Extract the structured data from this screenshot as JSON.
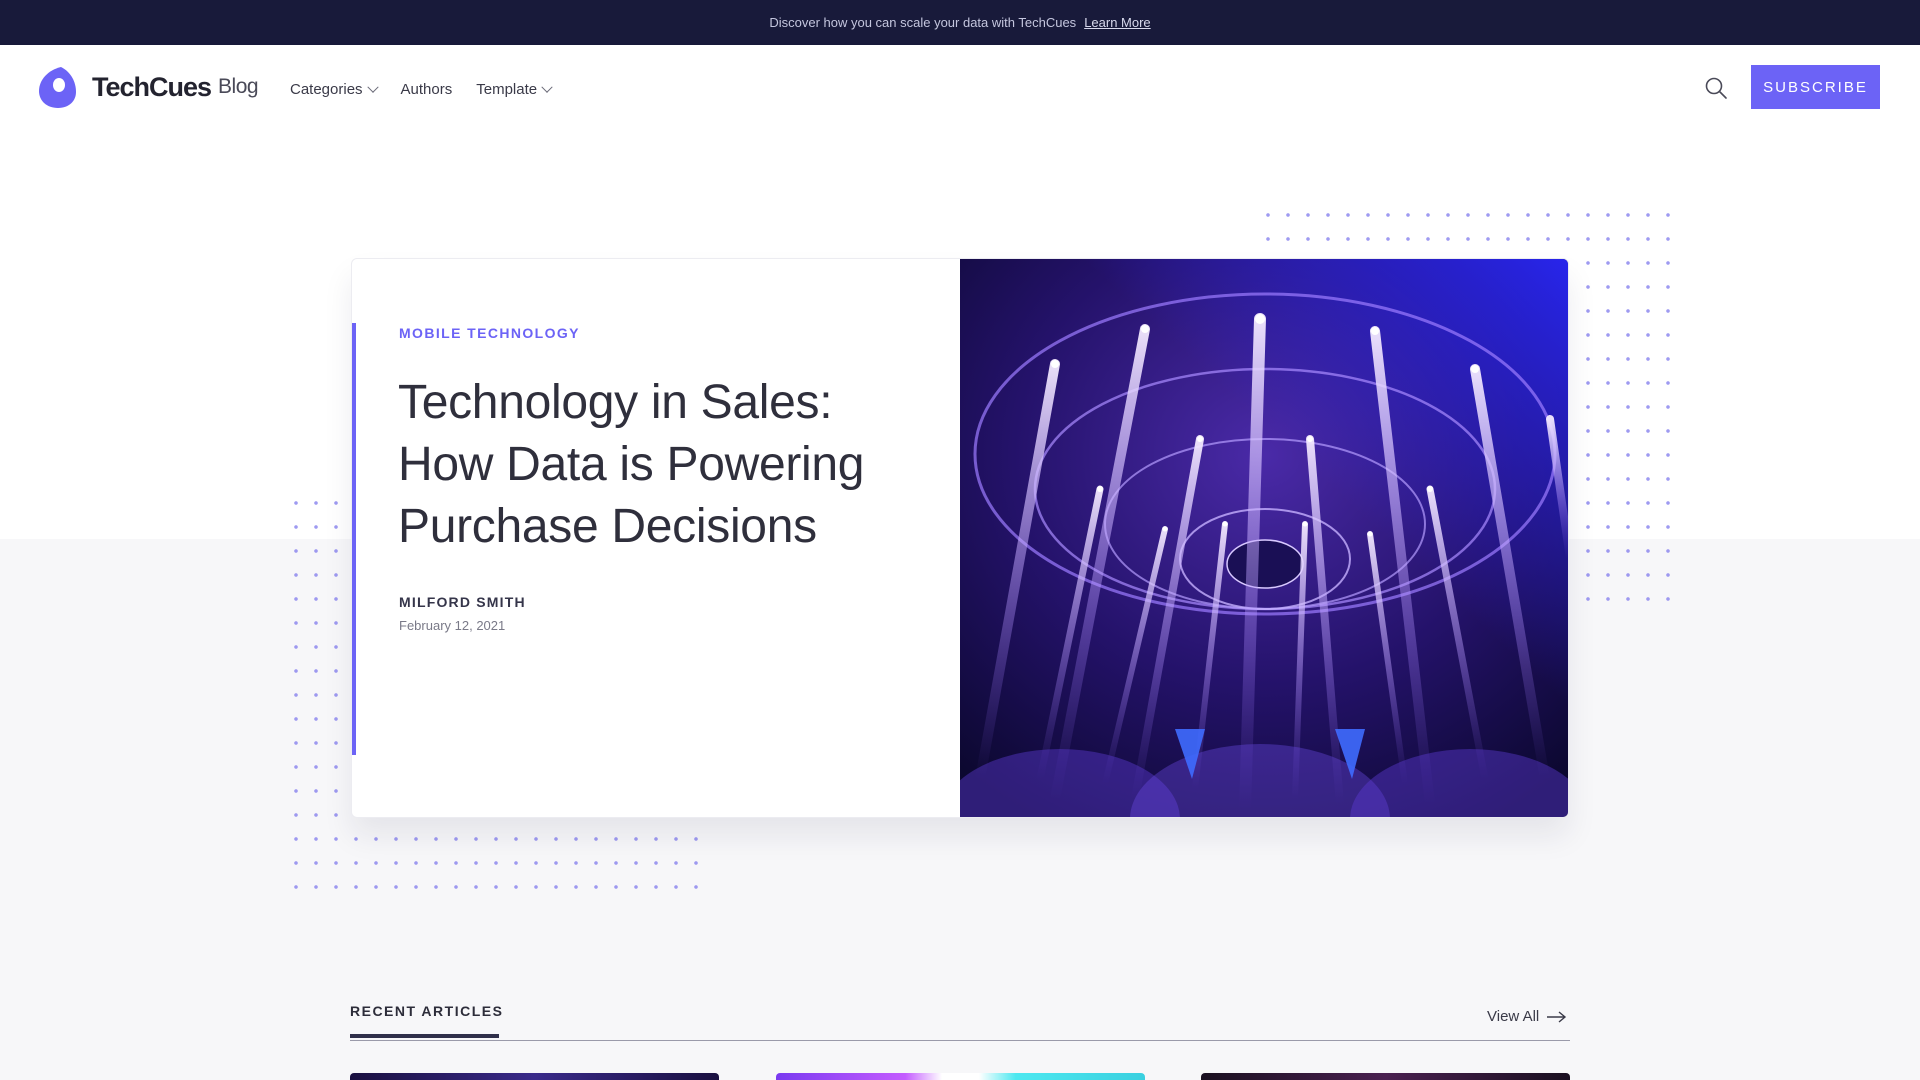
{
  "announcement": {
    "text": "Discover how you can scale your data with TechCues",
    "link": "Learn More"
  },
  "header": {
    "brand": "TechCues",
    "brand_sub": "Blog",
    "nav": [
      {
        "label": "Categories",
        "dropdown": true
      },
      {
        "label": "Authors",
        "dropdown": false
      },
      {
        "label": "Template",
        "dropdown": true
      }
    ],
    "subscribe_label": "SUBSCRIBE",
    "icons": {
      "search": "search-icon",
      "logo": "logo-mark-icon"
    }
  },
  "hero": {
    "category": "MOBILE TECHNOLOGY",
    "title": "Technology in Sales: How Data is Powering Purchase Decisions",
    "author": "MILFORD SMITH",
    "date": "February 12, 2021",
    "image": "concert-stage-lights"
  },
  "recent": {
    "heading": "RECENT ARTICLES",
    "view_all": "View All"
  },
  "colors": {
    "accent": "#6c63f6",
    "announce_bg": "#181a3a",
    "page_bg": "#f7f7f9"
  }
}
